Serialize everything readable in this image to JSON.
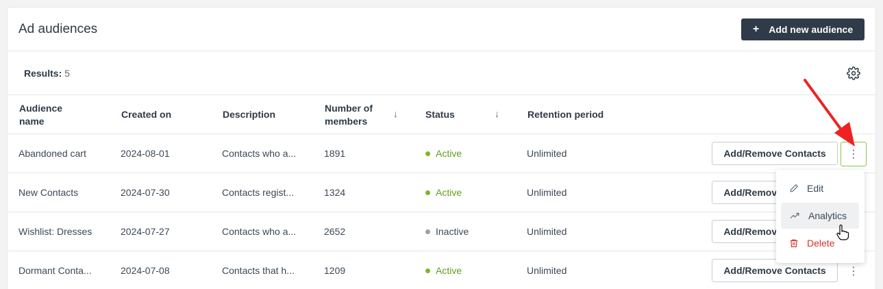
{
  "header": {
    "title": "Ad audiences",
    "add_button": "Add new audience",
    "add_icon": "+"
  },
  "results": {
    "label": "Results:",
    "count": "5"
  },
  "columns": [
    {
      "line1": "Audience",
      "line2": "name"
    },
    {
      "label": "Created on"
    },
    {
      "label": "Description"
    },
    {
      "line1": "Number of",
      "line2": "members"
    },
    {
      "label": "Status"
    },
    {
      "label": "Retention period"
    }
  ],
  "sort_icon": "↓",
  "rows": [
    {
      "name": "Abandoned cart",
      "created": "2024-08-01",
      "description": "Contacts who a...",
      "members": "1891",
      "status": "Active",
      "retention": "Unlimited",
      "action": "Add/Remove Contacts",
      "more": "⋮"
    },
    {
      "name": "New Contacts",
      "created": "2024-07-30",
      "description": "Contacts regist...",
      "members": "1324",
      "status": "Active",
      "retention": "Unlimited",
      "action": "Add/Remove Contacts",
      "more": "⋮"
    },
    {
      "name": "Wishlist: Dresses",
      "created": "2024-07-27",
      "description": "Contacts who a...",
      "members": "2652",
      "status": "Inactive",
      "retention": "Unlimited",
      "action": "Add/Remove Contacts",
      "more": "⋮"
    },
    {
      "name": "Dormant Conta...",
      "created": "2024-07-08",
      "description": "Contacts that h...",
      "members": "1209",
      "status": "Active",
      "retention": "Unlimited",
      "action": "Add/Remove Contacts",
      "more": "⋮"
    }
  ],
  "menu": {
    "edit": "Edit",
    "analytics": "Analytics",
    "delete": "Delete"
  },
  "colors": {
    "active": "#5f9e1b",
    "inactive": "#9aa1a9",
    "dot_active": "#7ab829",
    "delete": "#d9312b",
    "primary": "#2f3b48",
    "arrow": "#ee2222"
  }
}
